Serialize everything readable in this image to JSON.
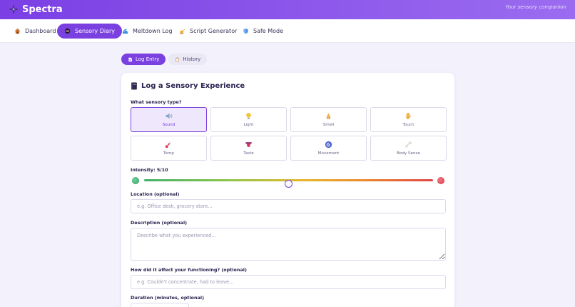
{
  "app": {
    "name": "Spectra",
    "tagline": "Your sensory companion"
  },
  "nav": {
    "items": [
      {
        "label": "Dashboard",
        "icon": "house-icon",
        "active": false
      },
      {
        "label": "Sensory Diary",
        "icon": "ninja-icon",
        "active": true
      },
      {
        "label": "Meltdown Log",
        "icon": "wave-icon",
        "active": false
      },
      {
        "label": "Script Generator",
        "icon": "writing-hand-icon",
        "active": false
      },
      {
        "label": "Safe Mode",
        "icon": "shield-icon",
        "active": false
      }
    ]
  },
  "subtabs": [
    {
      "label": "Log Entry",
      "icon": "page-icon",
      "active": true
    },
    {
      "label": "History",
      "icon": "clipboard-icon",
      "active": false
    }
  ],
  "form": {
    "title": "Log a Sensory Experience",
    "title_icon": "notebook-icon",
    "type_label": "What sensory type?",
    "types": [
      {
        "label": "Sound",
        "icon": "speaker-icon",
        "selected": true
      },
      {
        "label": "Light",
        "icon": "lightbulb-icon",
        "selected": false
      },
      {
        "label": "Smell",
        "icon": "nose-icon",
        "selected": false
      },
      {
        "label": "Touch",
        "icon": "hand-icon",
        "selected": false
      },
      {
        "label": "Temp",
        "icon": "thermometer-icon",
        "selected": false
      },
      {
        "label": "Taste",
        "icon": "tongue-icon",
        "selected": false
      },
      {
        "label": "Movement",
        "icon": "spiral-icon",
        "selected": false
      },
      {
        "label": "Body Sense",
        "icon": "bone-icon",
        "selected": false
      }
    ],
    "intensity": {
      "label": "Intensity: 5/10",
      "value": 5,
      "min": 0,
      "max": 10,
      "colors": {
        "low": "#3fb06b",
        "mid": "#e6b529",
        "high": "#e04545"
      }
    },
    "location": {
      "label": "Location (optional)",
      "placeholder": "e.g. Office desk, grocery store...",
      "value": ""
    },
    "description": {
      "label": "Description (optional)",
      "placeholder": "Describe what you experienced...",
      "value": ""
    },
    "functioning": {
      "label": "How did it affect your functioning? (optional)",
      "placeholder": "e.g. Couldn't concentrate, had to leave...",
      "value": ""
    },
    "duration": {
      "label": "Duration (minutes, optional)",
      "placeholder": "",
      "value": ""
    }
  },
  "colors": {
    "accent": "#7a40e0",
    "header_gradient_start": "#7b3fe4",
    "header_gradient_end": "#9b6cf0",
    "background": "#f3f1fb"
  }
}
